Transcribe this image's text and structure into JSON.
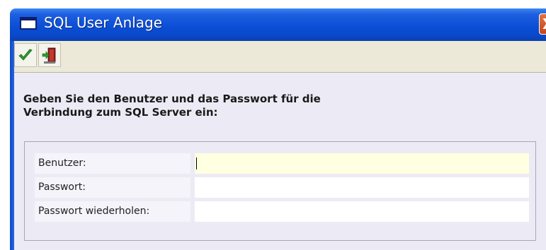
{
  "window": {
    "title": "SQL User Anlage",
    "close_label": "X"
  },
  "toolbar": {
    "buttons": [
      {
        "name": "confirm",
        "icon": "checkmark-icon"
      },
      {
        "name": "exit",
        "icon": "exit-door-icon"
      }
    ]
  },
  "content": {
    "intro_line1": "Geben Sie den Benutzer und das Passwort für die",
    "intro_line2": "Verbindung zum SQL Server ein:"
  },
  "form": {
    "user_label": "Benutzer:",
    "user_value": "",
    "password_label": "Passwort:",
    "password_value": "",
    "repeat_label": "Passwort wiederholen:",
    "repeat_value": ""
  },
  "colors": {
    "titlebar": "#0a4fd6",
    "client_background": "#ecebf5",
    "active_field": "#ffffe1",
    "close_button": "#d4582a"
  }
}
